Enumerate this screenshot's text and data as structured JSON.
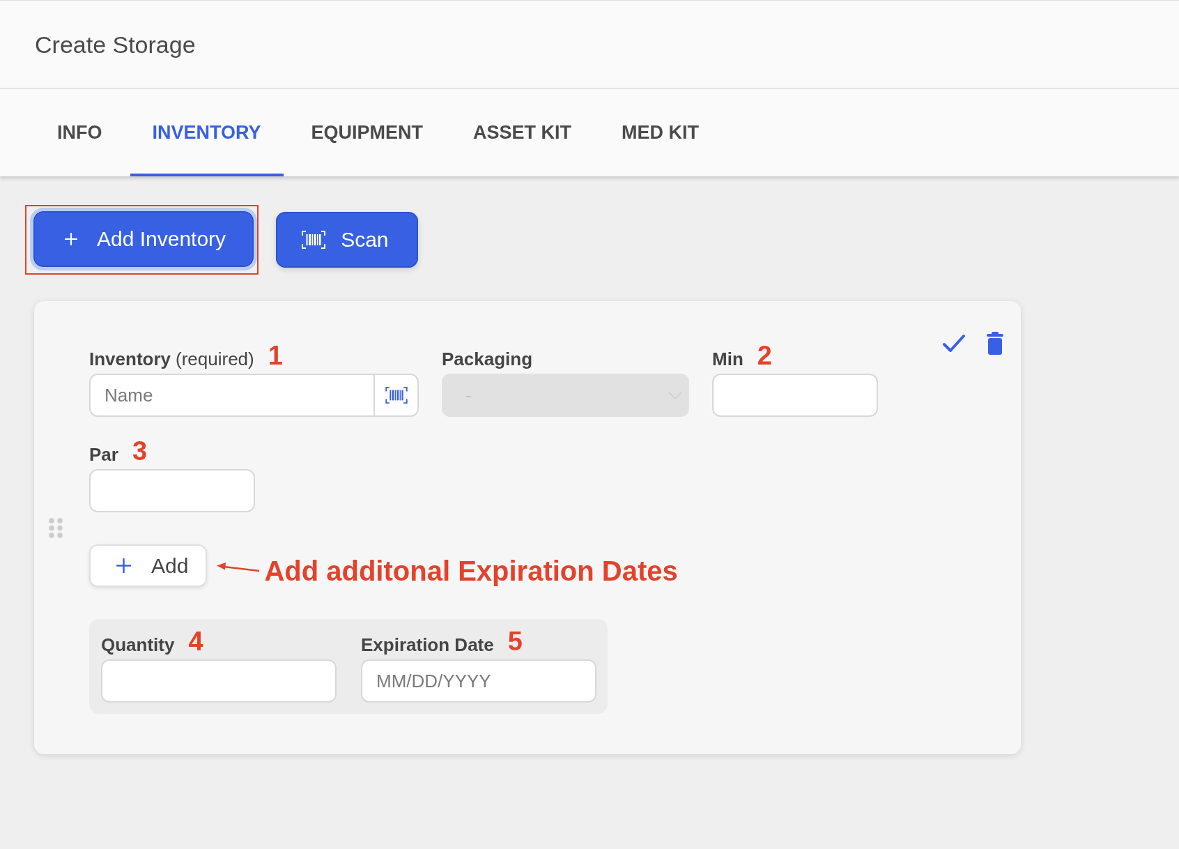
{
  "header": {
    "title": "Create Storage"
  },
  "tabs": [
    {
      "label": "INFO",
      "selected": false
    },
    {
      "label": "INVENTORY",
      "selected": true
    },
    {
      "label": "EQUIPMENT",
      "selected": false
    },
    {
      "label": "ASSET KIT",
      "selected": false
    },
    {
      "label": "MED KIT",
      "selected": false
    }
  ],
  "toolbar": {
    "buttons": [
      {
        "kind": "add",
        "label": "Add Inventory",
        "focused": true,
        "highlighted": true
      },
      {
        "kind": "scan",
        "label": "Scan",
        "focused": false,
        "highlighted": false
      }
    ]
  },
  "inventory_card": {
    "fields": [
      {
        "kind": "lookup",
        "label": "Inventory",
        "note": "(required)",
        "marker": "1",
        "placeholder": "Name"
      },
      {
        "kind": "select",
        "label": "Packaging",
        "value": "-",
        "disabled": true
      },
      {
        "kind": "text",
        "label": "Min",
        "marker": "2"
      },
      {
        "kind": "text",
        "label": "Par",
        "marker": "3"
      }
    ],
    "add_button": {
      "label": "Add"
    },
    "callout": {
      "text": "Add additonal Expiration Dates"
    },
    "expiration_entries": [
      {
        "fields": [
          {
            "label": "Quantity",
            "marker": "4"
          },
          {
            "label": "Expiration Date",
            "marker": "5",
            "placeholder": "MM/DD/YYYY"
          }
        ]
      }
    ]
  }
}
